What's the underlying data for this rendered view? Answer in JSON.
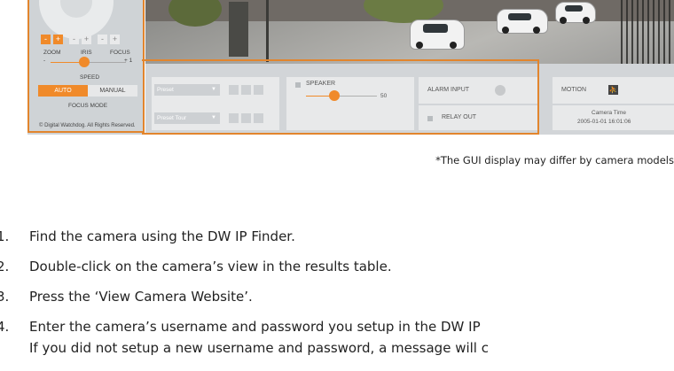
{
  "left_panel": {
    "zoom_buttons": [
      "-",
      "+"
    ],
    "iris_buttons": [
      "-",
      "+"
    ],
    "focus_buttons": [
      "-",
      "+"
    ],
    "labels": {
      "zoom": "ZOOM",
      "iris": "IRIS",
      "focus": "FOCUS"
    },
    "slider_min": "-",
    "slider_max": "+ 1",
    "speed_label": "SPEED",
    "auto_label": "AUTO",
    "manual_label": "MANUAL",
    "focus_mode_label": "FOCUS MODE",
    "copyright": "© Digital Watchdog. All Rights Reserved."
  },
  "controls": {
    "preset_placeholder": "Preset",
    "preset_tour_placeholder": "Preset Tour",
    "speaker_label": "SPEAKER",
    "speaker_value": "50",
    "alarm_input_label": "ALARM INPUT",
    "relay_out_label": "RELAY OUT",
    "motion_label": "MOTION",
    "camera_time_label": "Camera Time",
    "camera_time_value": "2005-01-01 16:01:06"
  },
  "colors": {
    "accent": "#f08a2a",
    "panel": "#d2d5d8"
  },
  "caption": "*The GUI display may differ by camera models",
  "steps": [
    {
      "num": "1.",
      "text": "Find the camera using the DW IP Finder."
    },
    {
      "num": "2.",
      "text": "Double-click on the camera’s view in the results table."
    },
    {
      "num": "3.",
      "text": "Press the ‘View Camera Website’."
    },
    {
      "num": "4.",
      "text": "Enter the camera’s username and password you setup in the DW IP"
    },
    {
      "num": "",
      "text": "If you did not setup a new username and password, a message will c"
    }
  ]
}
